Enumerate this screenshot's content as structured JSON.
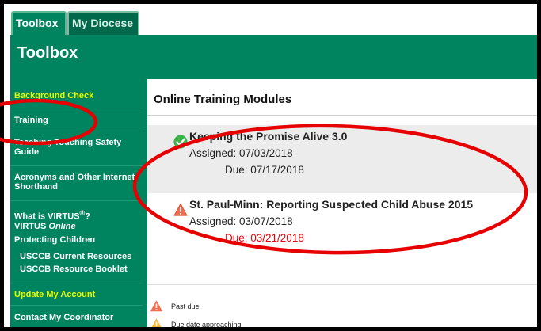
{
  "tabs": [
    {
      "label": "Toolbox"
    },
    {
      "label": "My Diocese"
    }
  ],
  "header": {
    "title": "Toolbox"
  },
  "sidebar": {
    "background_check": "Background Check",
    "training": "Training",
    "teaching_line1": "Teaching Touching Safety",
    "teaching_line2": "Guide",
    "acronyms_line1": "Acronyms and Other Internet",
    "acronyms_line2": "Shorthand",
    "what_is_virtus": "What is VIRTUS",
    "virtus_reg": "®",
    "virtus_q": "?",
    "virtus_word": "VIRTUS",
    "virtus_online": "Online",
    "protecting_children": "Protecting Children",
    "usccb_current": "USCCB Current Resources",
    "usccb_booklet": "USCCB Resource Booklet",
    "update_account": "Update My Account",
    "contact_coordinator": "Contact My Coordinator"
  },
  "main": {
    "title": "Online Training Modules",
    "modules": [
      {
        "title": "Keeping the Promise Alive 3.0",
        "assigned": "Assigned: 07/03/2018",
        "due": "Due: 07/17/2018",
        "status_icon": "check-icon"
      },
      {
        "title": "St. Paul-Minn: Reporting Suspected Child Abuse 2015",
        "assigned": "Assigned: 03/07/2018",
        "due": "Due: 03/21/2018",
        "status_icon": "warning-icon"
      }
    ],
    "legend": [
      {
        "label": "Past due",
        "icon": "warning-red-icon"
      },
      {
        "label": "Due date approaching",
        "icon": "warning-yellow-icon"
      }
    ]
  },
  "colors": {
    "brand_green": "#00845f",
    "sidebar_yellow": "#e6ff00",
    "overdue_red": "#e8000d",
    "annotation_red": "#e60000"
  }
}
